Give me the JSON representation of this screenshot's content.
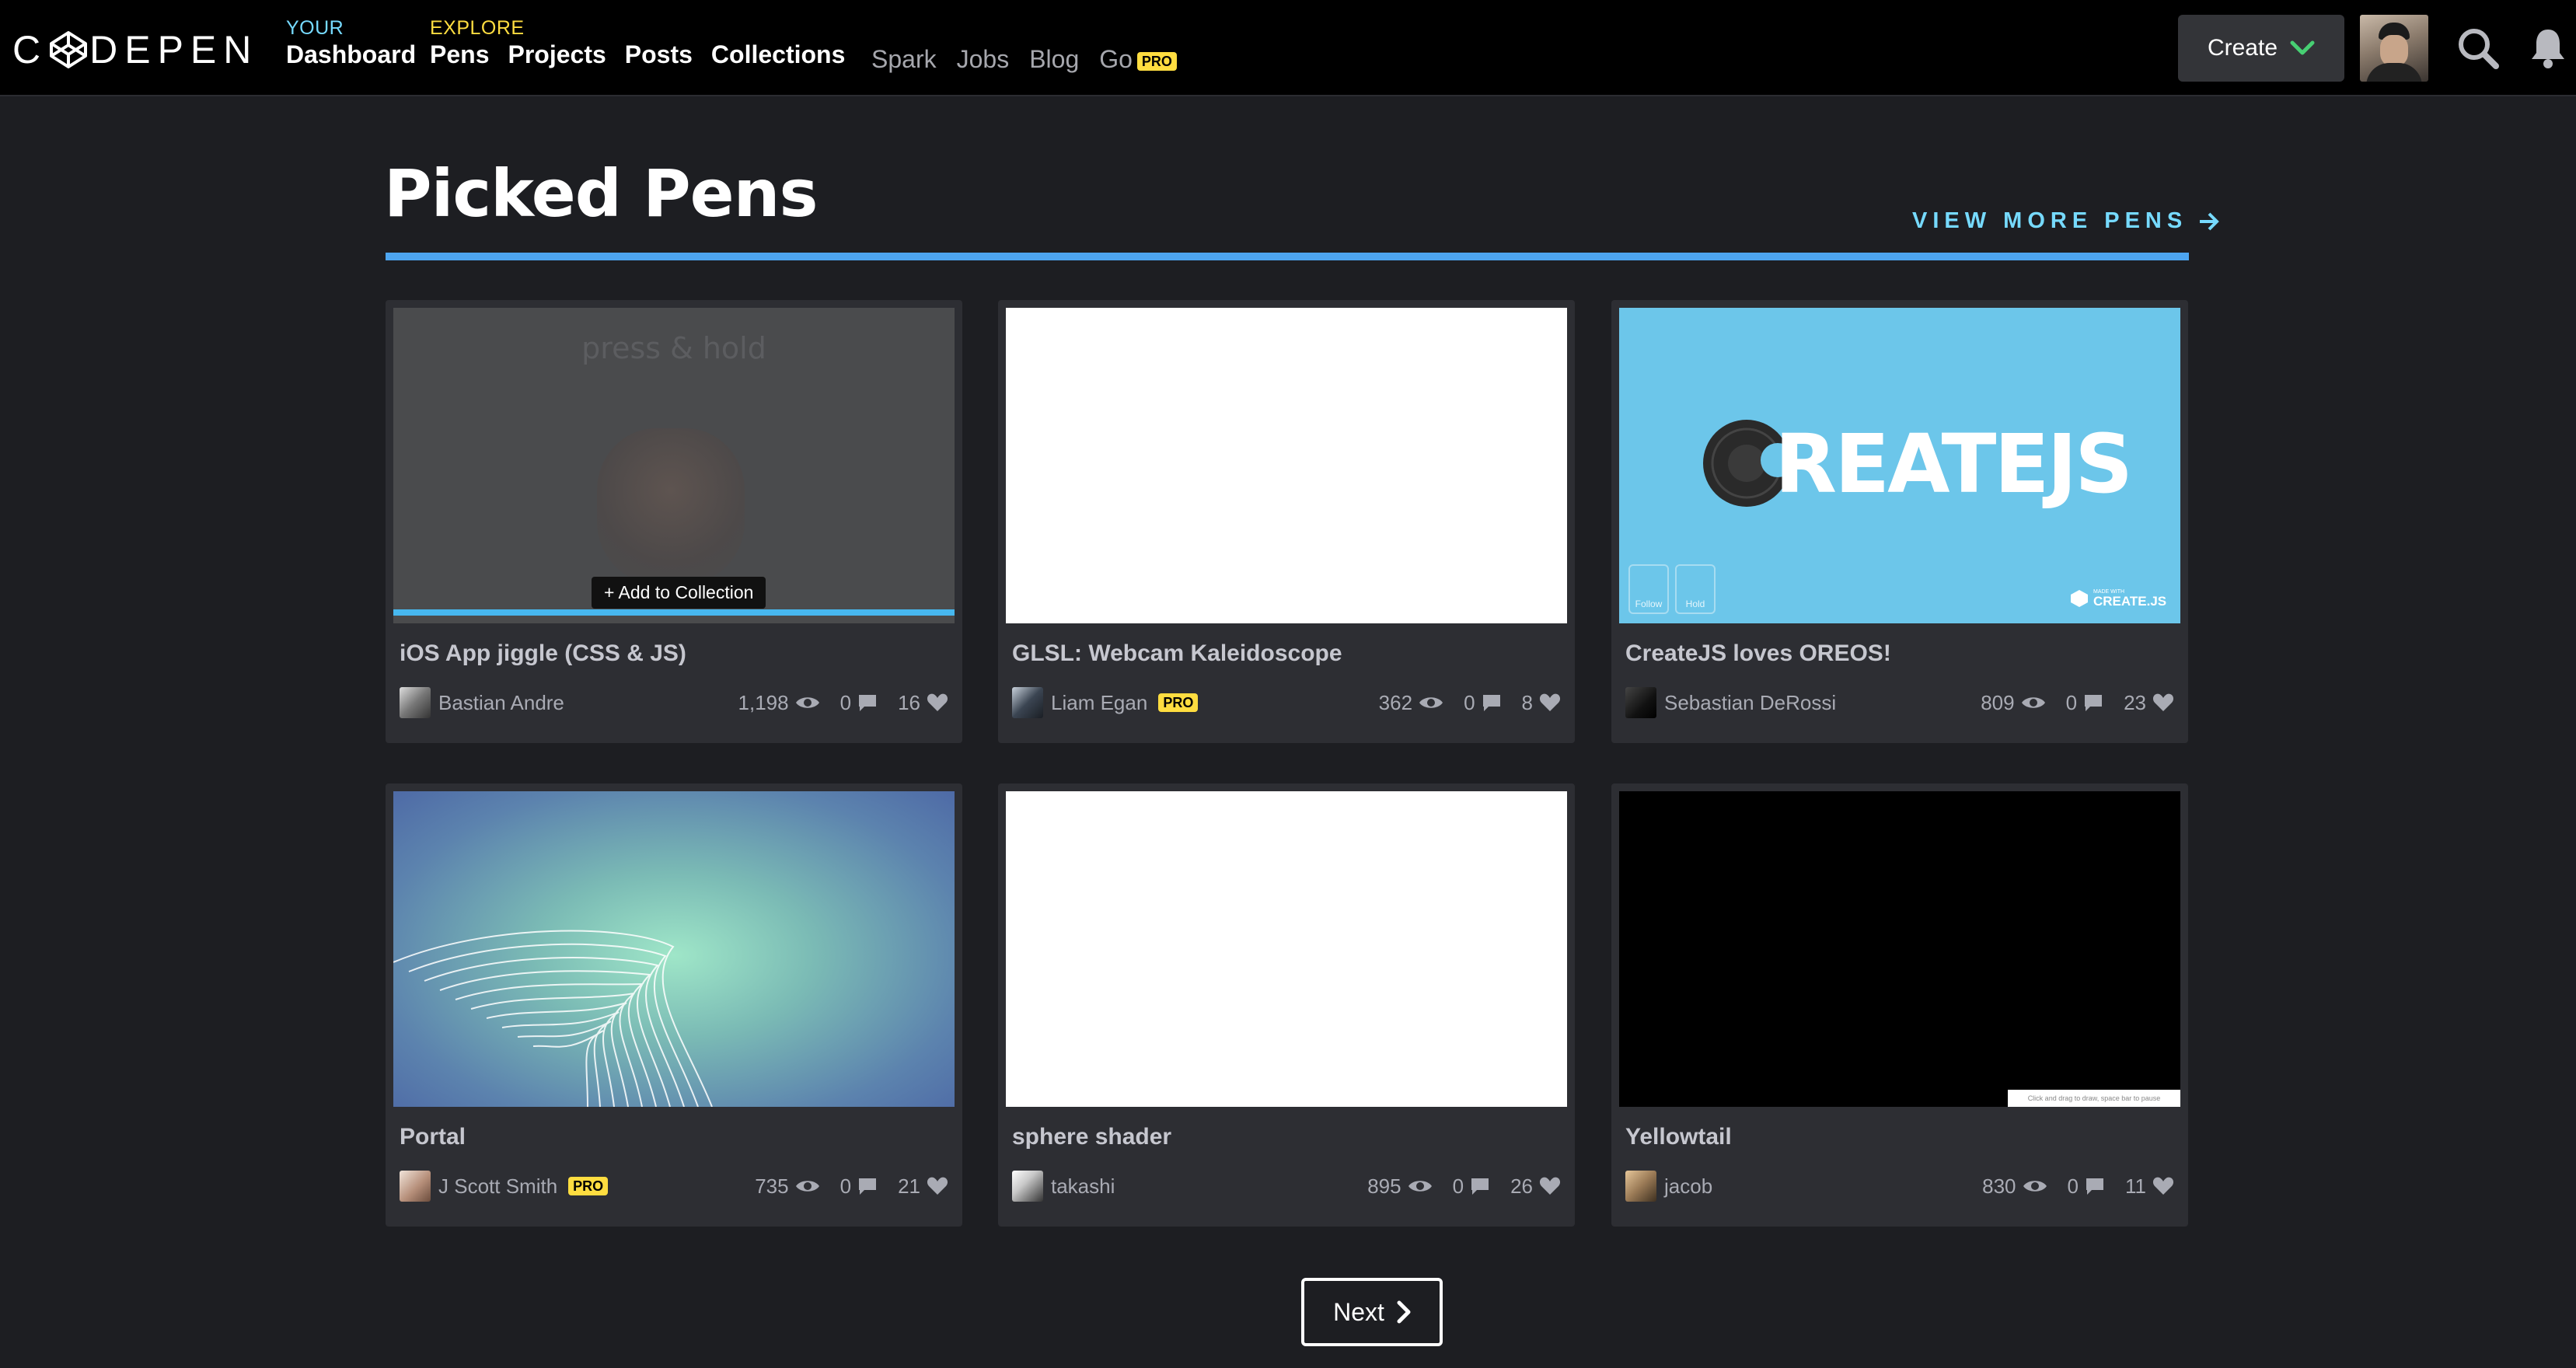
{
  "header": {
    "logo_text": "CODEPEN",
    "your_label": "YOUR",
    "explore_label": "EXPLORE",
    "nav_dashboard": "Dashboard",
    "nav_pens": "Pens",
    "nav_projects": "Projects",
    "nav_posts": "Posts",
    "nav_collections": "Collections",
    "nav_spark": "Spark",
    "nav_jobs": "Jobs",
    "nav_blog": "Blog",
    "nav_go": "Go",
    "pro_badge": "PRO",
    "create_label": "Create"
  },
  "main": {
    "title": "Picked Pens",
    "view_more": "VIEW MORE PENS",
    "add_to_collection": "+ Add to Collection",
    "next_label": "Next"
  },
  "pens": [
    {
      "title": "iOS App jiggle (CSS & JS)",
      "author": "Bastian Andre",
      "pro": false,
      "views": "1,198",
      "comments": "0",
      "likes": "16",
      "thumb_text": "press & hold"
    },
    {
      "title": "GLSL: Webcam Kaleidoscope",
      "author": "Liam Egan",
      "pro": true,
      "views": "362",
      "comments": "0",
      "likes": "8"
    },
    {
      "title": "CreateJS loves OREOS!",
      "author": "Sebastian DeRossi",
      "pro": false,
      "views": "809",
      "comments": "0",
      "likes": "23",
      "thumb_text": "REATEJS",
      "thumb_badge": "CREATE.JS",
      "thumb_badge_small": "MADE WITH",
      "thumb_follow": "Follow",
      "thumb_hold": "Hold"
    },
    {
      "title": "Portal",
      "author": "J Scott Smith",
      "pro": true,
      "views": "735",
      "comments": "0",
      "likes": "21"
    },
    {
      "title": "sphere shader",
      "author": "takashi",
      "pro": false,
      "views": "895",
      "comments": "0",
      "likes": "26"
    },
    {
      "title": "Yellowtail",
      "author": "jacob",
      "pro": false,
      "views": "830",
      "comments": "0",
      "likes": "11",
      "thumb_text": "Click and drag to draw, space bar to pause"
    }
  ],
  "colors": {
    "accent_blue": "#76daff",
    "explore_yellow": "#ffdd40",
    "rule_blue": "#4da5f0",
    "background": "#1d1e22",
    "card": "#2d2e33",
    "createjs_bg": "#6cc6ea"
  }
}
